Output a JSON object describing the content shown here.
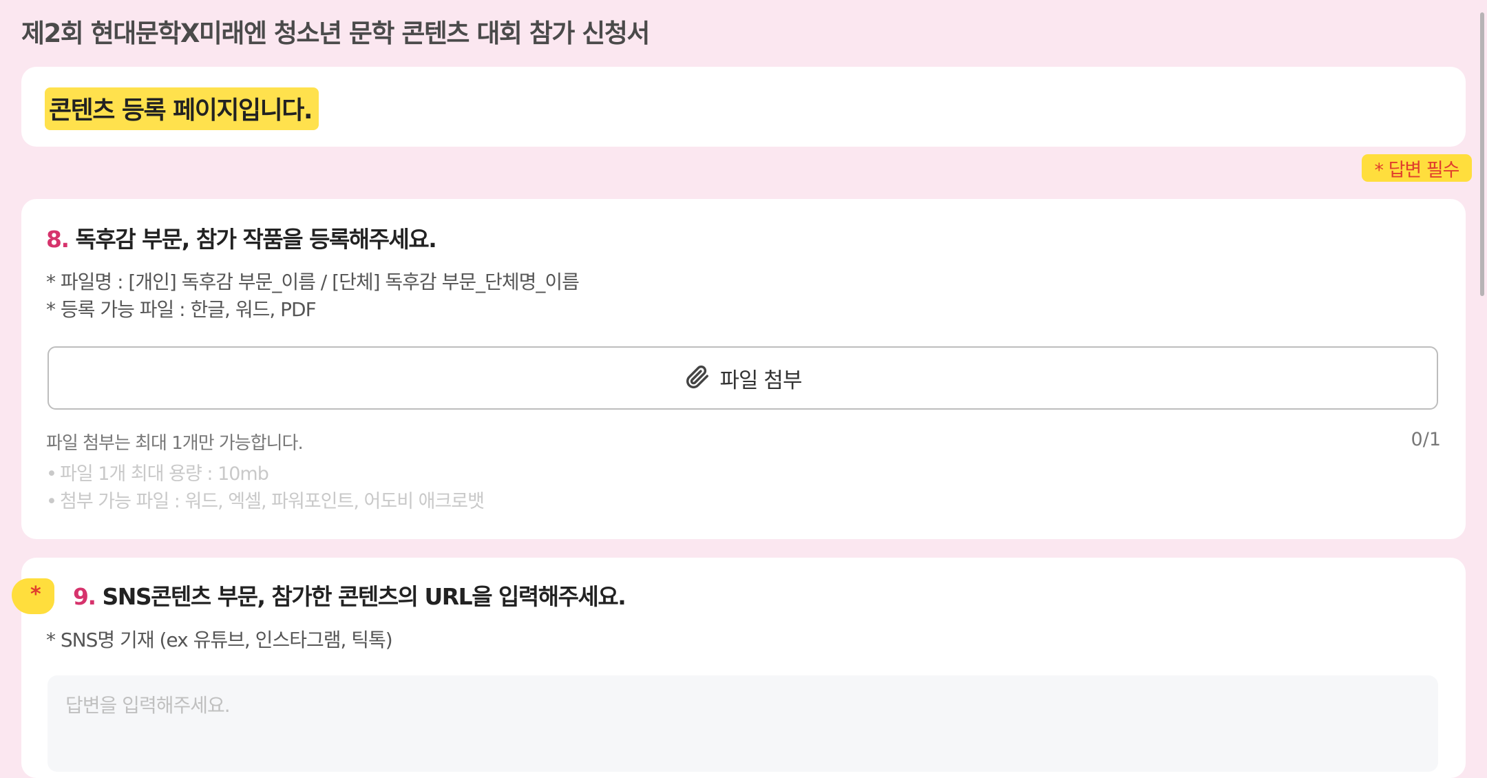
{
  "page": {
    "title": "제2회 현대문학X미래엔 청소년 문학 콘텐츠 대회 참가 신청서"
  },
  "intro": {
    "text": "콘텐츠 등록 페이지입니다."
  },
  "required_note": "* 답변 필수",
  "question8": {
    "number": "8.",
    "title": "독후감 부문, 참가 작품을 등록해주세요.",
    "desc": [
      "* 파일명 : [개인] 독후감 부문_이름 / [단체] 독후감 부문_단체명_이름",
      "* 등록 가능 파일 : 한글, 워드, PDF"
    ],
    "attach_label": "파일 첨부",
    "attach_icon": "paperclip-icon",
    "limit_text": "파일 첨부는 최대 1개만 가능합니다.",
    "count": "0/1",
    "info": [
      "파일 1개 최대 용량 : 10mb",
      "첨부 가능 파일 : 워드, 엑셀, 파워포인트, 어도비 애크로뱃"
    ]
  },
  "question9": {
    "required_mark": "*",
    "number": "9.",
    "title": "SNS콘텐츠 부문, 참가한 콘텐츠의 URL을 입력해주세요.",
    "desc": "* SNS명 기재 (ex 유튜브, 인스타그램, 틱톡)",
    "placeholder": "답변을 입력해주세요."
  },
  "colors": {
    "background": "#fbe7f0",
    "highlight": "#ffe14d",
    "question_number": "#d6336c",
    "required": "#e03e2d"
  }
}
